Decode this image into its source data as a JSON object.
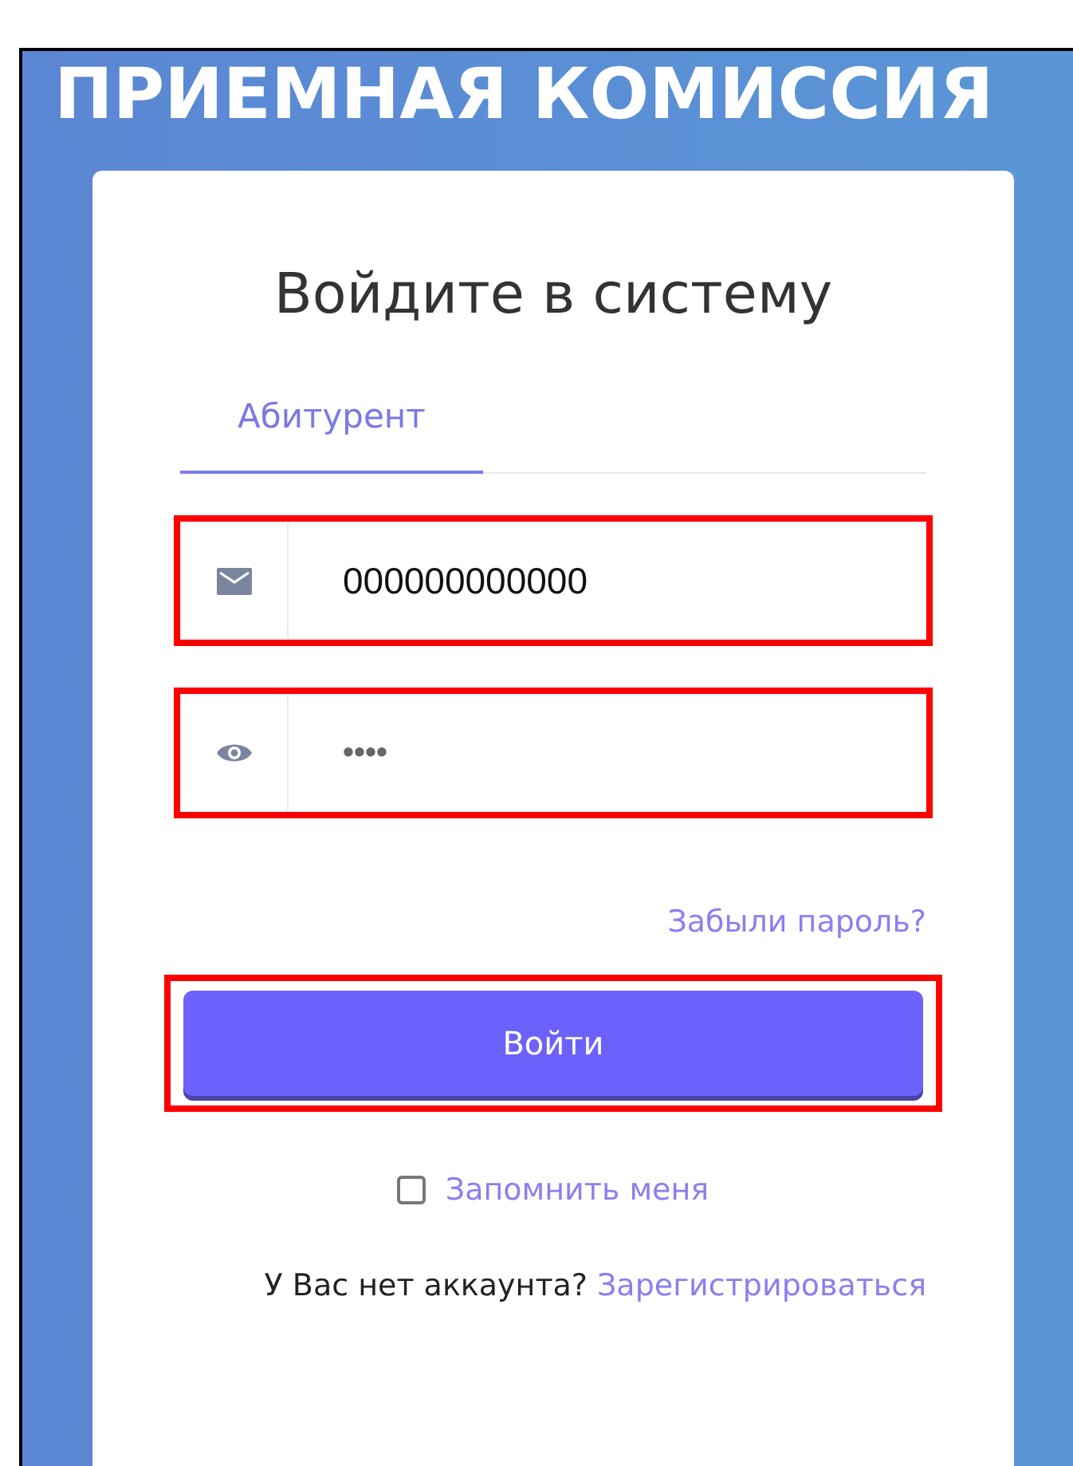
{
  "header": {
    "title": "ПРИЕМНАЯ КОМИССИЯ"
  },
  "login_card": {
    "heading": "Войдите в систему",
    "tabs": [
      {
        "label": "Абитурент",
        "selected": true
      }
    ],
    "fields": [
      {
        "kind": "email",
        "value": "000000000000",
        "highlighted": true
      },
      {
        "kind": "password",
        "value": "••••",
        "highlighted": true
      }
    ],
    "forgot_link": "Забыли пароль?",
    "submit_button": {
      "label": "Войти",
      "highlighted": true
    },
    "remember_me": {
      "label": "Запомнить меня",
      "checked": false
    },
    "register_prompt": {
      "text": "У Вас нет аккаунта?",
      "link": "Зарегистрироваться"
    }
  }
}
